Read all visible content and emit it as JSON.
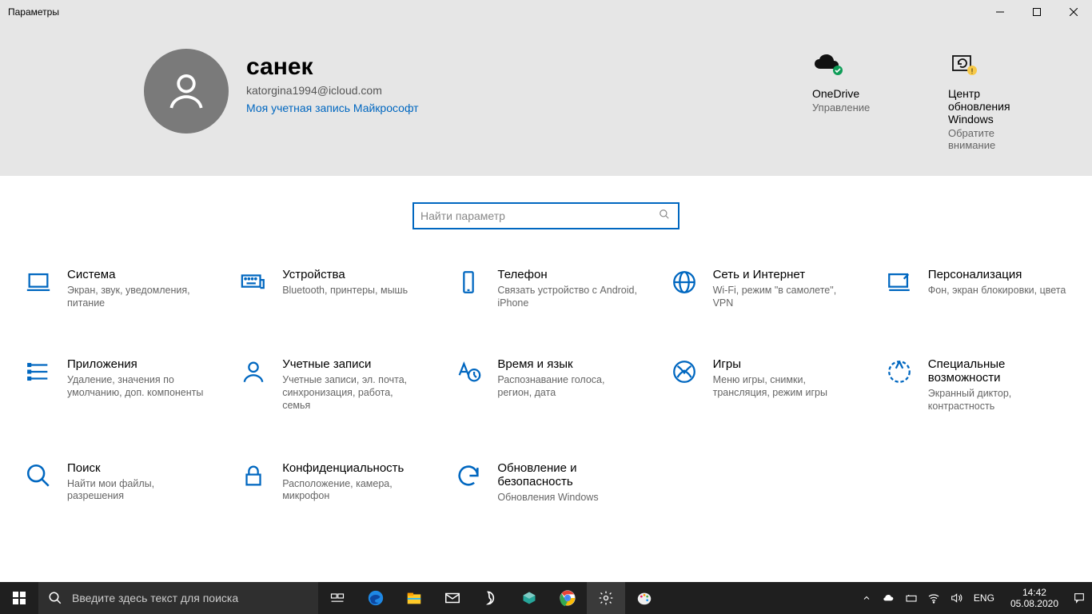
{
  "window": {
    "title": "Параметры"
  },
  "profile": {
    "name": "санек",
    "email": "katorgina1994@icloud.com",
    "link": "Моя учетная запись Майкрософт"
  },
  "header_tiles": {
    "onedrive": {
      "title": "OneDrive",
      "sub": "Управление"
    },
    "update": {
      "title": "Центр обновления Windows",
      "sub": "Обратите внимание"
    }
  },
  "search": {
    "placeholder": "Найти параметр"
  },
  "categories": [
    {
      "title": "Система",
      "desc": "Экран, звук, уведомления, питание"
    },
    {
      "title": "Устройства",
      "desc": "Bluetooth, принтеры, мышь"
    },
    {
      "title": "Телефон",
      "desc": "Связать устройство с Android, iPhone"
    },
    {
      "title": "Сеть и Интернет",
      "desc": "Wi-Fi, режим \"в самолете\", VPN"
    },
    {
      "title": "Персонализация",
      "desc": "Фон, экран блокировки, цвета"
    },
    {
      "title": "Приложения",
      "desc": "Удаление, значения по умолчанию, доп. компоненты"
    },
    {
      "title": "Учетные записи",
      "desc": "Учетные записи, эл. почта, синхронизация, работа, семья"
    },
    {
      "title": "Время и язык",
      "desc": "Распознавание голоса, регион, дата"
    },
    {
      "title": "Игры",
      "desc": "Меню игры, снимки, трансляция, режим игры"
    },
    {
      "title": "Специальные возможности",
      "desc": "Экранный диктор, контрастность"
    },
    {
      "title": "Поиск",
      "desc": "Найти мои файлы, разрешения"
    },
    {
      "title": "Конфиденциальность",
      "desc": "Расположение, камера, микрофон"
    },
    {
      "title": "Обновление и безопасность",
      "desc": "Обновления Windows"
    }
  ],
  "taskbar": {
    "search_placeholder": "Введите здесь текст для поиска",
    "lang": "ENG",
    "time": "14:42",
    "date": "05.08.2020"
  }
}
